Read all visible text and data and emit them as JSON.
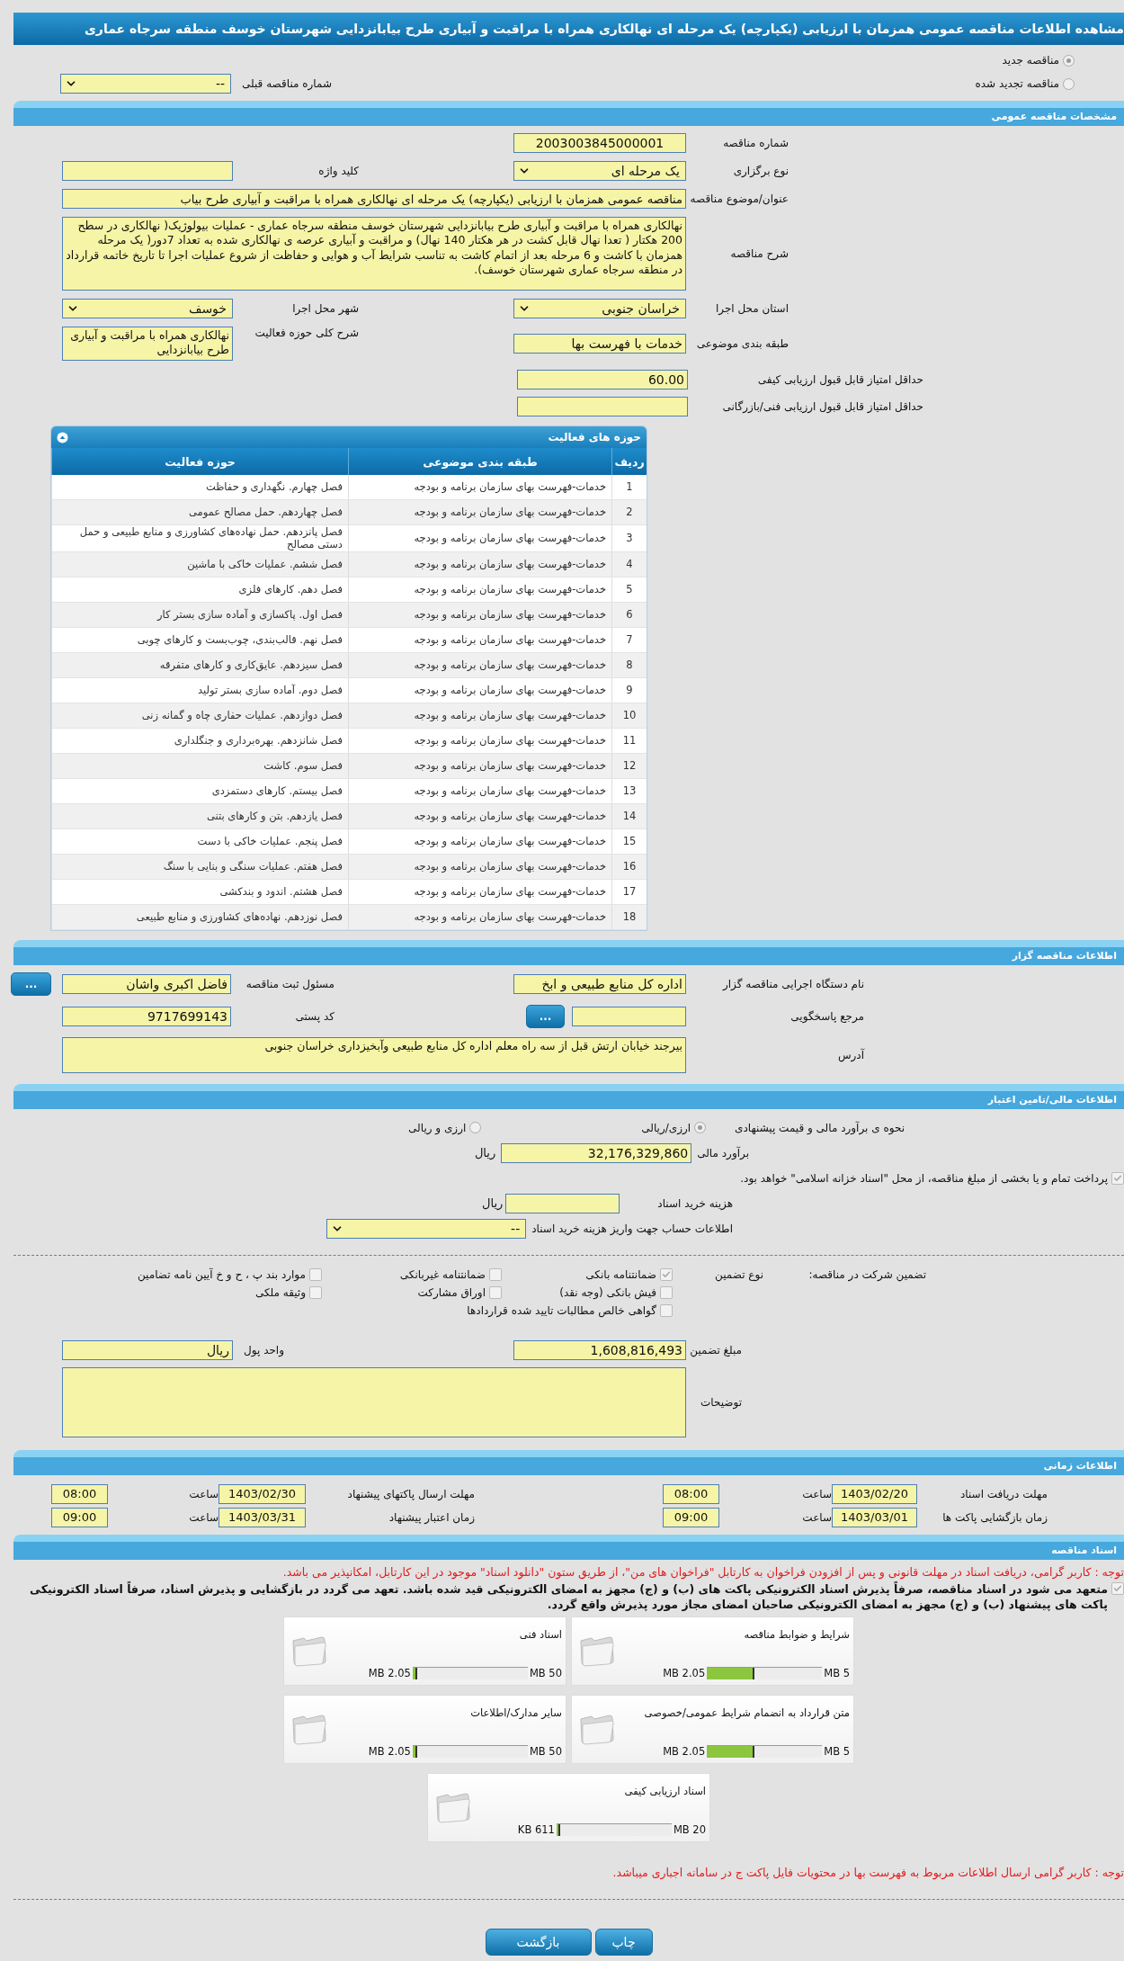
{
  "title": "مشاهده اطلاعات مناقصه عمومی همزمان با ارزیابی (یکپارچه) یک مرحله ای نهالکاری همراه با مراقبت و آبیاری طرح بیابانزدایی شهرستان خوسف منطقه سرجاه عماری",
  "tender_kind": [
    {
      "label": "مناقصه جدید",
      "selected": true
    },
    {
      "label": "مناقصه تجدید شده",
      "selected": false
    }
  ],
  "previous_tender": {
    "label": "شماره مناقصه قبلی",
    "value": "--"
  },
  "general": {
    "heading": "مشخصات مناقصه عمومی",
    "tender_number": {
      "label": "شماره مناقصه",
      "value": "2003003845000001"
    },
    "holding_type": {
      "label": "نوع برگزاری",
      "value": "یک مرحله ای"
    },
    "keyword": {
      "label": "کلید واژه"
    },
    "subject": {
      "label": "عنوان/موضوع مناقصه",
      "value": "مناقصه عمومی همزمان با ارزیابی (یکپارچه) یک مرحله ای نهالکاری همراه با مراقبت و آبیاری طرح بیاب"
    },
    "description": {
      "label": "شرح مناقصه",
      "value": "نهالکاری همراه با مراقبت و آبیاری طرح بیابانزدایی  شهرستان خوسف منطقه سرجاه عماری - عملیات بیولوژیک( نهالکاری در سطح  200 هکتار ( تعدا نهال قابل کشت در هر هکتار 140 نهال) و مراقبت و آبیاری عرصه ی نهالکاری شده به تعداد 7دور( یک مرحله همزمان با کاشت و 6 مرحله بعد از اتمام کاشت به تناسب شرایط آب  و هوایی و حفاظت از شروع عملیات اجرا تا تاریخ خاتمه قرارداد در منطقه سرجاه عماری شهرستان خوسف)."
    },
    "province": {
      "label": "استان محل اجرا",
      "value": "خراسان جنوبی"
    },
    "city": {
      "label": "شهر محل اجرا",
      "value": "خوسف"
    },
    "category": {
      "label": "طبقه بندی موضوعی",
      "value": "خدمات با فهرست بها"
    },
    "activity_summary": {
      "label": "شرح کلی حوزه فعالیت",
      "value": "نهالکاری همراه با مراقبت و آبیاری طرح بیابانزدایی"
    },
    "min_quality_score": {
      "label": "حداقل امتیاز قابل قبول ارزیابی کیفی",
      "value": "60.00"
    },
    "min_technical_score": {
      "label": "حداقل امتیاز قابل قبول ارزیابی فنی/بازرگانی"
    }
  },
  "activities": {
    "heading": "حوزه های فعالیت",
    "columns": [
      "ردیف",
      "طبقه بندی موضوعی",
      "حوزه فعالیت"
    ],
    "rows": [
      [
        "1",
        "خدمات-فهرست بهای سازمان برنامه و بودجه",
        "فصل چهارم. نگهداری و حفاظت"
      ],
      [
        "2",
        "خدمات-فهرست بهای سازمان برنامه و بودجه",
        "فصل چهاردهم. حمل مصالح عمومی"
      ],
      [
        "3",
        "خدمات-فهرست بهای سازمان برنامه و بودجه",
        "فصل پانزدهم. حمل نهاده‌های کشاورزی و منابع طبیعی و حمل دستی مصالح"
      ],
      [
        "4",
        "خدمات-فهرست بهای سازمان برنامه و بودجه",
        "فصل ششم. عملیات خاکی با ماشین"
      ],
      [
        "5",
        "خدمات-فهرست بهای سازمان برنامه و بودجه",
        "فصل دهم. کارهای فلزی"
      ],
      [
        "6",
        "خدمات-فهرست بهای سازمان برنامه و بودجه",
        "فصل اول. پاکسازی و آماده سازی بستر کار"
      ],
      [
        "7",
        "خدمات-فهرست بهای سازمان برنامه و بودجه",
        "فصل نهم. قالب‌بندی، چوب‌بست و کارهای چوبی"
      ],
      [
        "8",
        "خدمات-فهرست بهای سازمان برنامه و بودجه",
        "فصل سیزدهم. عایق‌کاری و کارهای متفرقه"
      ],
      [
        "9",
        "خدمات-فهرست بهای سازمان برنامه و بودجه",
        "فصل دوم. آماده سازی بستر تولید"
      ],
      [
        "10",
        "خدمات-فهرست بهای سازمان برنامه و بودجه",
        "فصل دوازدهم. عملیات حفاری چاه و گمانه زنی"
      ],
      [
        "11",
        "خدمات-فهرست بهای سازمان برنامه و بودجه",
        "فصل شانزدهم. بهره‌برداری و جنگلداری"
      ],
      [
        "12",
        "خدمات-فهرست بهای سازمان برنامه و بودجه",
        "فصل سوم. کاشت"
      ],
      [
        "13",
        "خدمات-فهرست بهای سازمان برنامه و بودجه",
        "فصل بیستم. کارهای دستمزدی"
      ],
      [
        "14",
        "خدمات-فهرست بهای سازمان برنامه و بودجه",
        "فصل یازدهم. بتن و کارهای بتنی"
      ],
      [
        "15",
        "خدمات-فهرست بهای سازمان برنامه و بودجه",
        "فصل پنجم. عملیات خاکی با دست"
      ],
      [
        "16",
        "خدمات-فهرست بهای سازمان برنامه و بودجه",
        "فصل هفتم. عملیات سنگی و بنایی با سنگ"
      ],
      [
        "17",
        "خدمات-فهرست بهای سازمان برنامه و بودجه",
        "فصل هشتم. اندود و بندکشی"
      ],
      [
        "18",
        "خدمات-فهرست بهای سازمان برنامه و بودجه",
        "فصل  نوزدهم. نهاده‌های کشاورزی و منابع طبیعی"
      ]
    ]
  },
  "organizer": {
    "heading": "اطلاعات مناقصه گزار",
    "agency": {
      "label": "نام دستگاه اجرایی مناقصه گزار",
      "value": "اداره کل منابع طبیعی و ابخ"
    },
    "registrar": {
      "label": "مسئول ثبت مناقصه",
      "value": "فاضل اکبری واشان",
      "button": "..."
    },
    "reference": {
      "label": "مرجع پاسخگویی",
      "button": "..."
    },
    "postal_code": {
      "label": "کد پستی",
      "value": "9717699143"
    },
    "address": {
      "label": "آدرس",
      "value": "بیرجند خیابان ارتش قبل از سه راه معلم اداره کل منابع طبیعی وآبخیزداری خراسان جنوبی"
    }
  },
  "finance": {
    "heading": "اطلاعات مالی/تامین اعتبار",
    "estimate_method": {
      "label": "نحوه ی برآورد مالی و قیمت پیشنهادی",
      "options": [
        {
          "label": "ارزی/ریالی",
          "selected": true
        },
        {
          "label": "ارزی و ریالی",
          "selected": false
        }
      ]
    },
    "estimate": {
      "label": "برآورد مالی",
      "value": "32,176,329,860",
      "unit": "ریال"
    },
    "treasury_note": {
      "text": "پرداخت تمام و یا بخشی از مبلغ مناقصه، از محل \"اسناد خزانه اسلامی\" خواهد بود.",
      "checked": true
    },
    "document_cost": {
      "label": "هزینه خرید اسناد",
      "unit": "ریال"
    },
    "account": {
      "label": "اطلاعات حساب جهت واریز هزینه خرید اسناد",
      "value": "--"
    }
  },
  "guarantee": {
    "label": "تضمین شرکت در مناقصه:",
    "type_label": "نوع تضمین",
    "options": [
      {
        "label": "ضمانتنامه بانکی",
        "checked": true
      },
      {
        "label": "ضمانتنامه غیربانکی",
        "checked": false
      },
      {
        "label": "موارد بند پ ، ح و خ آیین نامه تضامین",
        "checked": false
      },
      {
        "label": "فیش بانکی (وجه نقد)",
        "checked": false
      },
      {
        "label": "اوراق مشارکت",
        "checked": false
      },
      {
        "label": "وثیقه ملکی",
        "checked": false
      },
      {
        "label": "گواهی خالص مطالبات تایید شده قراردادها",
        "checked": false
      }
    ],
    "amount": {
      "label": "مبلغ تضمین",
      "value": "1,608,816,493"
    },
    "currency": {
      "label": "واحد پول",
      "value": "ریال"
    },
    "notes": {
      "label": "توضیحات"
    }
  },
  "schedule": {
    "heading": "اطلاعات زمانی",
    "items": [
      {
        "label": "مهلت دریافت اسناد",
        "date": "1403/02/20",
        "time_label": "ساعت",
        "time": "08:00"
      },
      {
        "label": "مهلت ارسال پاکتهای پیشنهاد",
        "date": "1403/02/30",
        "time_label": "ساعت",
        "time": "08:00"
      },
      {
        "label": "زمان بازگشایی پاکت ها",
        "date": "1403/03/01",
        "time_label": "ساعت",
        "time": "09:00"
      },
      {
        "label": "زمان اعتبار پیشنهاد",
        "date": "1403/03/31",
        "time_label": "ساعت",
        "time": "09:00"
      }
    ]
  },
  "documents": {
    "heading": "اسناد مناقصه",
    "notice": "توجه : کاربر گرامی، دریافت اسناد در مهلت قانونی و پس از افزودن فراخوان به کارتابل \"فراخوان های من\"، از طریق ستون \"دانلود اسناد\" موجود در این کارتابل، امکانپذیر می باشد.",
    "commitment": {
      "text": "متعهد می شود در اسناد مناقصه، صرفاً پذیرش اسناد الکترونیکی پاکت های (ب) و (ج) مجهز به امضای الکترونیکی قید شده باشد. تعهد می گردد در بازگشایی و پذیرش اسناد، صرفاً اسناد الکترونیکی پاکت های پیشنهاد (ب) و (ج) مجهز به امضای الکترونیکی صاحبان امضای مجاز مورد پذیرش واقع گردد.",
      "checked": true
    },
    "files": [
      {
        "name": "شرایط و ضوابط مناقصه",
        "size": "2.05 MB",
        "max": "5 MB",
        "level": 0.41
      },
      {
        "name": "اسناد فنی",
        "size": "2.05 MB",
        "max": "50 MB",
        "level": 0.04
      },
      {
        "name": "متن قرارداد به انضمام شرایط عمومی/خصوصی",
        "size": "2.05 MB",
        "max": "5 MB",
        "level": 0.41
      },
      {
        "name": "سایر مدارک/اطلاعات",
        "size": "2.05 MB",
        "max": "50 MB",
        "level": 0.04
      },
      {
        "name": "اسناد ارزیابی کیفی",
        "size": "611 KB",
        "max": "20 MB",
        "level": 0.03
      }
    ],
    "footer_note": "توجه : کاربر گرامی ارسال اطلاعات مربوط به فهرست بها در محتویات فایل پاکت ج در سامانه اجباری میباشد."
  },
  "buttons": [
    {
      "label": "چاپ"
    },
    {
      "label": "بازگشت"
    }
  ]
}
